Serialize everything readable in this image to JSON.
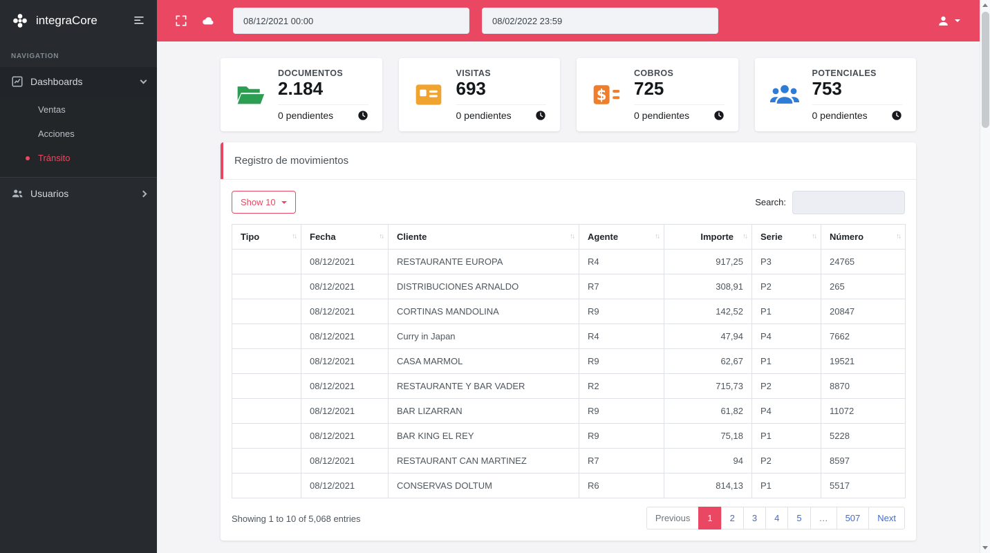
{
  "colors": {
    "accent": "#ea4862",
    "link": "#3e6cd6"
  },
  "sidebar": {
    "brand": "integraCore",
    "section_label": "NAVIGATION",
    "dashboards_label": "Dashboards",
    "dashboard_items": [
      {
        "label": "Ventas",
        "active": false
      },
      {
        "label": "Acciones",
        "active": false
      },
      {
        "label": "Tránsito",
        "active": true
      }
    ],
    "usuarios_label": "Usuarios"
  },
  "topbar": {
    "date_from": "08/12/2021 00:00",
    "date_to": "08/02/2022 23:59"
  },
  "stats": [
    {
      "title": "DOCUMENTOS",
      "value": "2.184",
      "pending": "0 pendientes",
      "icon": "open-folder-icon",
      "color": "#2b9e52"
    },
    {
      "title": "VISITAS",
      "value": "693",
      "pending": "0 pendientes",
      "icon": "id-card-icon",
      "color": "#f0a32f"
    },
    {
      "title": "COBROS",
      "value": "725",
      "pending": "0 pendientes",
      "icon": "money-check-icon",
      "color": "#ee7d2c"
    },
    {
      "title": "POTENCIALES",
      "value": "753",
      "pending": "0 pendientes",
      "icon": "users-icon",
      "color": "#2e7cd6"
    }
  ],
  "panel": {
    "title": "Registro de movimientos",
    "show_button_label": "Show 10",
    "search_label": "Search:",
    "search_value": "",
    "table": {
      "sort_glyph": "↑↓",
      "columns": [
        "Tipo",
        "Fecha",
        "Cliente",
        "Agente",
        "Importe",
        "Serie",
        "Número"
      ],
      "rows": [
        [
          "",
          "08/12/2021",
          "RESTAURANTE EUROPA",
          "R4",
          "917,25",
          "P3",
          "24765"
        ],
        [
          "",
          "08/12/2021",
          "DISTRIBUCIONES ARNALDO",
          "R7",
          "308,91",
          "P2",
          "265"
        ],
        [
          "",
          "08/12/2021",
          "CORTINAS MANDOLINA",
          "R9",
          "142,52",
          "P1",
          "20847"
        ],
        [
          "",
          "08/12/2021",
          "Curry in Japan",
          "R4",
          "47,94",
          "P4",
          "7662"
        ],
        [
          "",
          "08/12/2021",
          "CASA MARMOL",
          "R9",
          "62,67",
          "P1",
          "19521"
        ],
        [
          "",
          "08/12/2021",
          "RESTAURANTE Y BAR VADER",
          "R2",
          "715,73",
          "P2",
          "8870"
        ],
        [
          "",
          "08/12/2021",
          "BAR LIZARRAN",
          "R9",
          "61,82",
          "P4",
          "11072"
        ],
        [
          "",
          "08/12/2021",
          "BAR KING EL REY",
          "R9",
          "75,18",
          "P1",
          "5228"
        ],
        [
          "",
          "08/12/2021",
          "RESTAURANT CAN MARTINEZ",
          "R7",
          "94",
          "P2",
          "8597"
        ],
        [
          "",
          "08/12/2021",
          "CONSERVAS DOLTUM",
          "R6",
          "814,13",
          "P1",
          "5517"
        ]
      ]
    },
    "footer": {
      "showing": "Showing 1 to 10 of 5,068 entries",
      "pagination": [
        {
          "label": "Previous",
          "type": "disabled"
        },
        {
          "label": "1",
          "type": "active"
        },
        {
          "label": "2",
          "type": "link"
        },
        {
          "label": "3",
          "type": "link"
        },
        {
          "label": "4",
          "type": "link"
        },
        {
          "label": "5",
          "type": "link"
        },
        {
          "label": "…",
          "type": "ellipsis"
        },
        {
          "label": "507",
          "type": "link"
        },
        {
          "label": "Next",
          "type": "link"
        }
      ]
    }
  }
}
